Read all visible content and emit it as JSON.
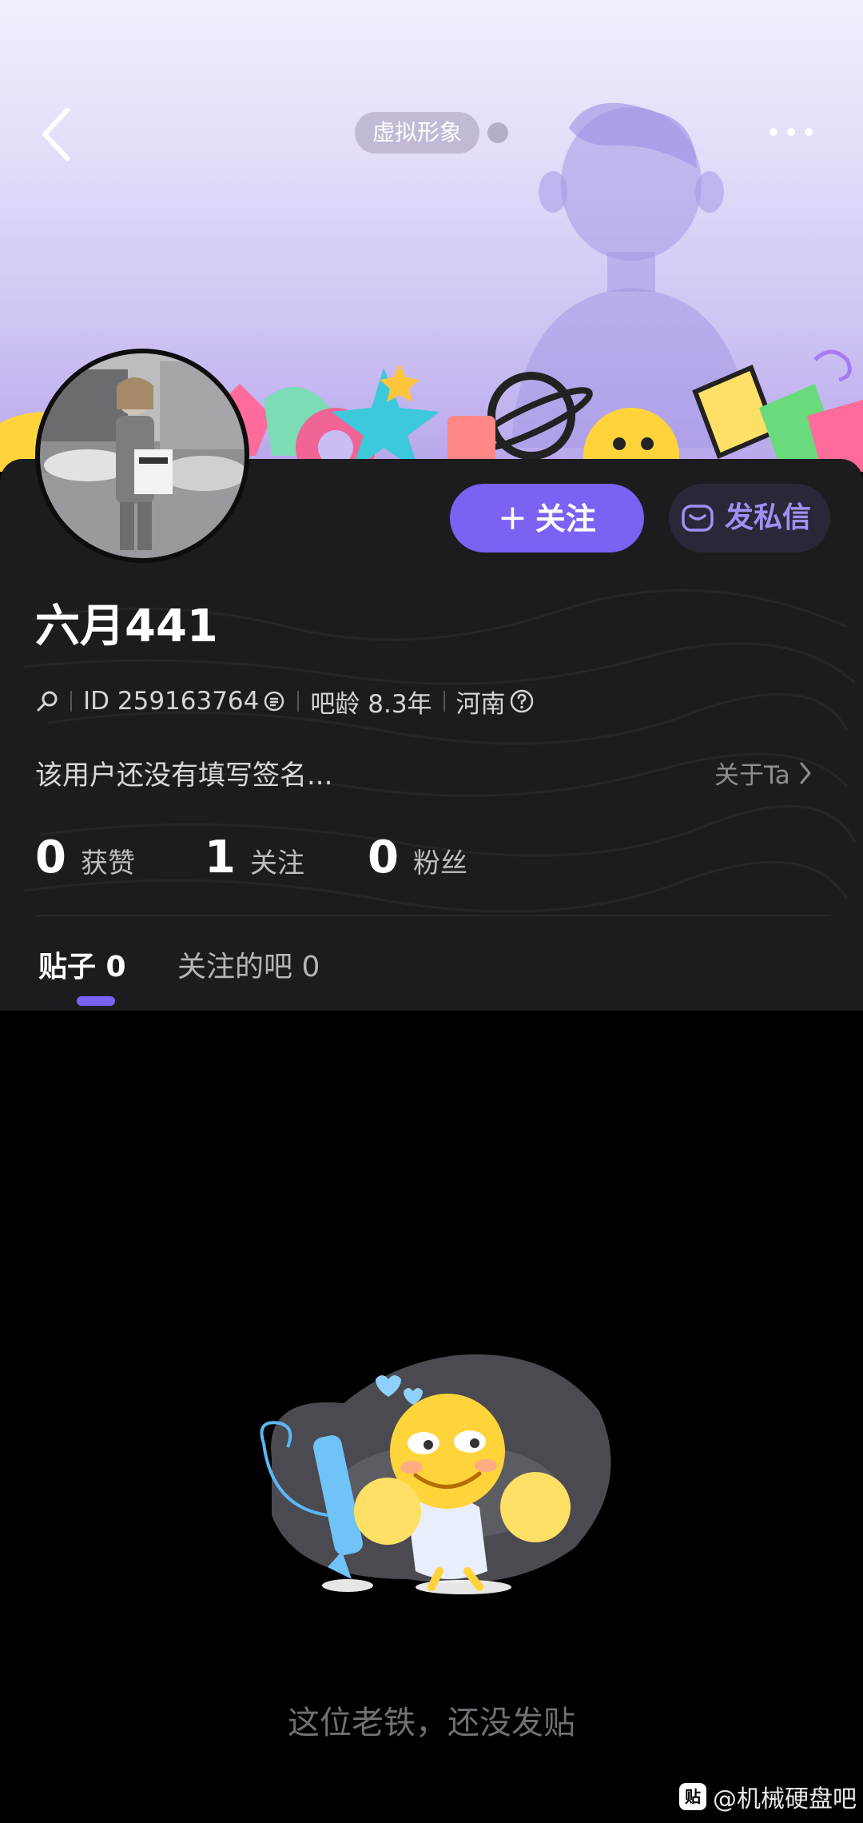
{
  "header": {
    "avatar_pill_label": "虚拟形象"
  },
  "actions": {
    "follow_label": "关注",
    "follow_plus": "+",
    "dm_label": "发私信"
  },
  "profile": {
    "username": "六月441",
    "id_text": "ID 259163764",
    "bar_age": "吧龄 8.3年",
    "location": "河南",
    "signature": "该用户还没有填写签名...",
    "about_label": "关于Ta"
  },
  "stats": [
    {
      "value": "0",
      "label": "获赞"
    },
    {
      "value": "1",
      "label": "关注"
    },
    {
      "value": "0",
      "label": "粉丝"
    }
  ],
  "tabs": [
    {
      "label": "贴子 0"
    },
    {
      "label": "关注的吧 0"
    }
  ],
  "empty_state": {
    "message": "这位老铁，还没发贴"
  },
  "watermark": {
    "logo_text": "贴",
    "text": "@机械硬盘吧"
  },
  "colors": {
    "accent": "#7b62f2",
    "panel": "#1c1c1e",
    "background": "#000000"
  },
  "icons": [
    "back-arrow-icon",
    "more-dots-icon",
    "mail-icon",
    "search-icon",
    "copy-icon",
    "question-icon",
    "chevron-right-icon"
  ]
}
